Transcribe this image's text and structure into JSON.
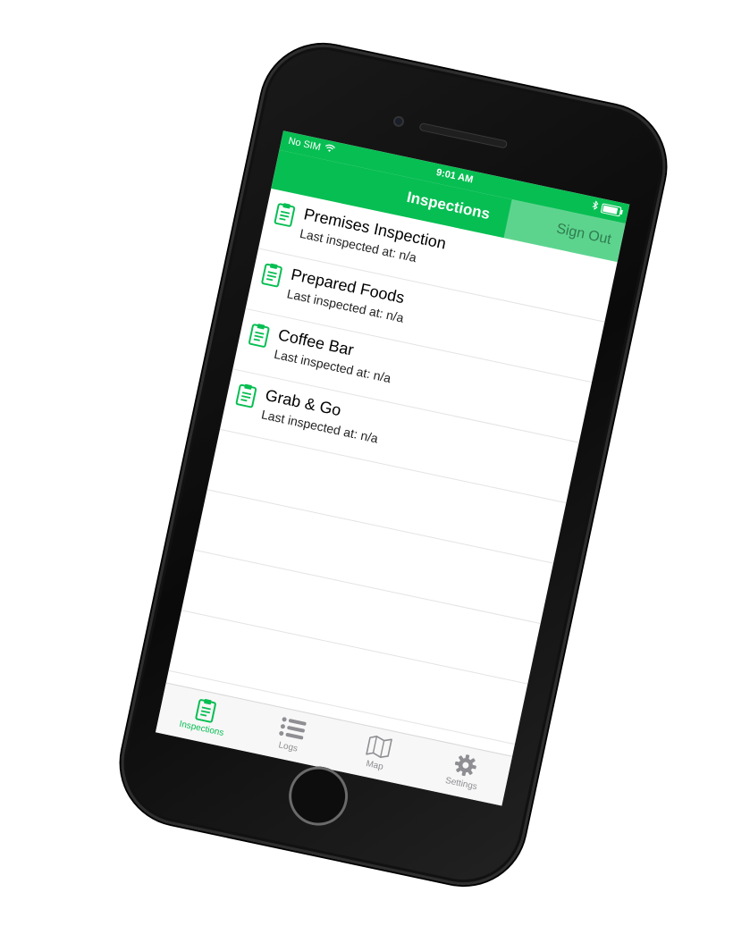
{
  "status_bar": {
    "carrier": "No SIM",
    "time": "9:01 AM"
  },
  "nav": {
    "title": "Inspections",
    "sign_out_label": "Sign Out"
  },
  "inspections": [
    {
      "title": "Premises Inspection",
      "subtitle": "Last inspected at: n/a"
    },
    {
      "title": "Prepared Foods",
      "subtitle": "Last inspected at: n/a"
    },
    {
      "title": "Coffee Bar",
      "subtitle": "Last inspected at: n/a"
    },
    {
      "title": "Grab & Go",
      "subtitle": "Last inspected at: n/a"
    }
  ],
  "tabs": [
    {
      "label": "Inspections",
      "icon": "clipboard-icon",
      "active": true
    },
    {
      "label": "Logs",
      "icon": "list-icon",
      "active": false
    },
    {
      "label": "Map",
      "icon": "map-icon",
      "active": false
    },
    {
      "label": "Settings",
      "icon": "gear-icon",
      "active": false
    }
  ],
  "colors": {
    "accent": "#07be52",
    "tab_inactive": "#8e8e93"
  }
}
